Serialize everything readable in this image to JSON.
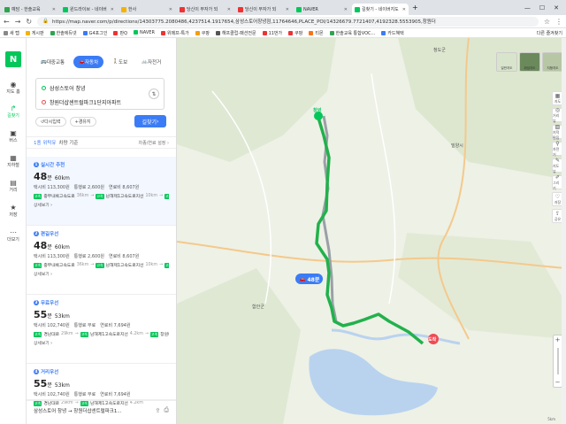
{
  "browser": {
    "tabs": [
      {
        "label": "예담 - 한솔교육",
        "color": "#2ea44f",
        "active": false
      },
      {
        "label": "윈드라이브 - 네이버",
        "color": "#03c75a",
        "active": false
      },
      {
        "label": "한사",
        "color": "#f5b301",
        "active": false
      },
      {
        "label": "당신이 부자가 되",
        "color": "#e33",
        "active": false
      },
      {
        "label": "당신이 부자가 되",
        "color": "#e33",
        "active": false
      },
      {
        "label": "NAVER",
        "color": "#03c75a",
        "active": false
      },
      {
        "label": "길찾기 - 네이버지도",
        "color": "#03c75a",
        "active": true
      }
    ],
    "url": "https://map.naver.com/p/directions/14303775.2080486,4237514.1917654,삼성스토어창녕점,11764646,PLACE_POI/14326679.7721407,4192328.5553905,창원더",
    "bookmarks": [
      "새 탭",
      "게시판",
      "한솔에듀넷",
      "G4포그인",
      "판Q",
      "NAVER",
      "위메프-특가",
      "쿠팡",
      "해프클럽-패션전문",
      "11번가",
      "쿠팡",
      "티몬",
      "한솔교육 통합VOC...",
      "카드혜택"
    ],
    "bookmarks_right": "다른 즐겨찾기"
  },
  "leftbar": {
    "logo": "N",
    "items": [
      {
        "label": "지도 홈",
        "icon": "map-pin-icon"
      },
      {
        "label": "길찾기",
        "icon": "directions-icon",
        "active": true
      },
      {
        "label": "버스",
        "icon": "bus-icon"
      },
      {
        "label": "지하철",
        "icon": "subway-icon"
      },
      {
        "label": "거리",
        "icon": "street-icon"
      },
      {
        "label": "저장",
        "icon": "star-icon"
      },
      {
        "label": "더보기",
        "icon": "more-icon"
      }
    ]
  },
  "panel": {
    "modes": [
      "대중교통",
      "자동차",
      "도보",
      "자전거"
    ],
    "start": "삼성스토어 창녕",
    "end": "창원더샵센트럴파크1단지아파트",
    "sub_buttons": [
      "다시입력",
      "경유지"
    ],
    "find_label": "길찾기",
    "sort_selected": "1종 위탁유",
    "sort_label": "차량 기준",
    "sort_right": "차종/연료 설정 ›",
    "routes": [
      {
        "num": "1",
        "tag": "실시간 추천",
        "time": "48",
        "unit": "분",
        "distance": "60km",
        "taxi": "택시비 113,300원",
        "toll": "통행료 2,600원",
        "fuel": "연료비 8,607원",
        "roads": [
          [
            "중부내륙고속도로",
            "36km"
          ],
          [
            "남해제1고속도로지선",
            "10km"
          ],
          [
            "창원대로",
            "9.6km"
          ]
        ],
        "detail": "상세보기"
      },
      {
        "num": "2",
        "tag": "편길우선",
        "time": "48",
        "unit": "분",
        "distance": "60km",
        "taxi": "택시비 113,300원",
        "toll": "통행료 2,600원",
        "fuel": "연료비 8,607원",
        "roads": [
          [
            "중부내륙고속도로",
            "36km"
          ],
          [
            "남해제1고속도로지선",
            "10km"
          ],
          [
            "창원대로",
            "9.6km"
          ]
        ],
        "detail": "상세보기"
      },
      {
        "num": "3",
        "tag": "무료우선",
        "time": "55",
        "unit": "분",
        "distance": "53km",
        "taxi": "택시비 102,740원",
        "toll": "통행료 무료",
        "fuel": "연료비 7,694원",
        "roads": [
          [
            "경남대로",
            "29km"
          ],
          [
            "남해제1고속도로지선",
            "4.2km"
          ],
          [
            "창원대로",
            "9.0km"
          ]
        ],
        "detail": "상세보기"
      },
      {
        "num": "4",
        "tag": "거리우선",
        "time": "55",
        "unit": "분",
        "distance": "53km",
        "taxi": "택시비 102,740원",
        "toll": "통행료 무료",
        "fuel": "연료비 7,694원",
        "roads": [
          [
            "경남대로",
            "29km"
          ],
          [
            "남해제1고속도로지선",
            "4.2km"
          ]
        ],
        "detail": "상세보기"
      }
    ],
    "summary": "삼성스토어 창녕 → 창원더샵센트럴파크1..."
  },
  "map": {
    "time_badge": "48분",
    "type_buttons": [
      "일반지도",
      "위성지도",
      "지형지도"
    ],
    "tools": [
      "지도",
      "거리뷰",
      "지적편집",
      "자전거",
      "지도뷰",
      "그리기",
      "저장",
      "공유"
    ],
    "labels": [
      {
        "text": "청도군"
      },
      {
        "text": "밀양시"
      },
      {
        "text": "함안군"
      },
      {
        "text": "창녕"
      },
      {
        "text": "도착"
      }
    ],
    "scale": "5km"
  }
}
